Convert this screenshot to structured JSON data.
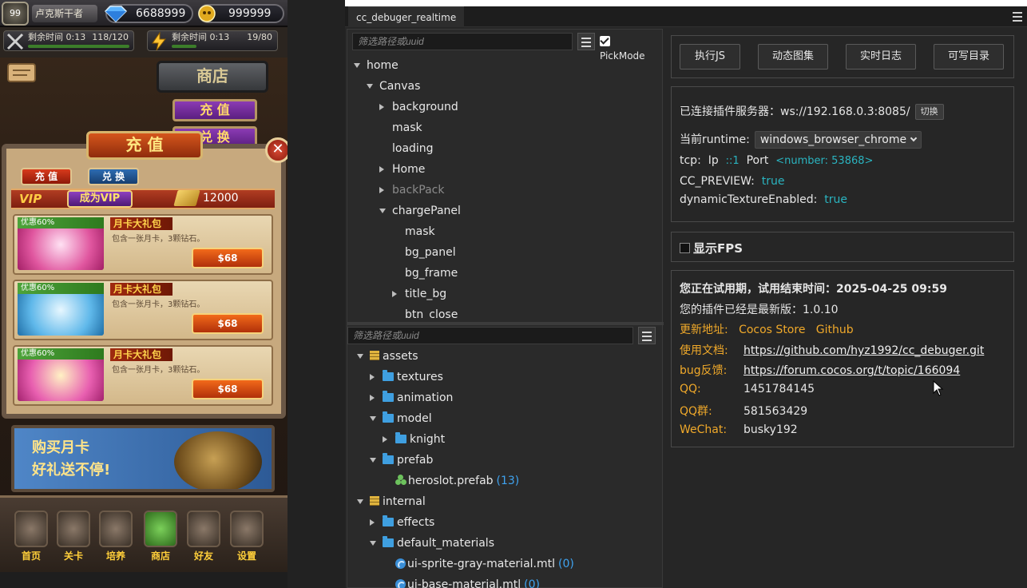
{
  "game": {
    "level": "99",
    "player_name": "卢克斯干者",
    "diamonds": "6688999",
    "gold": "999999",
    "timer1_label": "剩余时间",
    "timer1_time": "0:13",
    "timer1_count": "118/120",
    "timer1_progress": 0.98,
    "timer2_label": "剩余时间",
    "timer2_time": "0:13",
    "timer2_count": "19/80",
    "timer2_progress": 0.24,
    "shop_sign": "商店",
    "recharge_btn": "充 值",
    "second_btn": "兑 换",
    "charge_title": "充 值",
    "close_label": "✕",
    "tab_recharge": "充 值",
    "tab_exchange": "兑 换",
    "vip_label": "VIP",
    "become_vip": "成为VIP",
    "vip_amount": "12000",
    "cards": [
      {
        "discount": "优惠60%",
        "title": "月卡大礼包",
        "desc": "包含一张月卡，3颗钻石。",
        "price": "$68"
      },
      {
        "discount": "优惠60%",
        "title": "月卡大礼包",
        "desc": "包含一张月卡，3颗钻石。",
        "price": "$68"
      },
      {
        "discount": "优惠60%",
        "title": "月卡大礼包",
        "desc": "包含一张月卡，3颗钻石。",
        "price": "$68"
      }
    ],
    "banner_line1": "购买月卡",
    "banner_line2": "好礼送不停!",
    "nav": [
      "首页",
      "关卡",
      "培养",
      "商店",
      "好友",
      "设置"
    ]
  },
  "debuger": {
    "tab_title": "cc_debuger_realtime",
    "node_filter_placeholder": "筛选路径或uuid",
    "pick_mode": "PickMode",
    "node_tree": [
      {
        "label": "home",
        "level": 0,
        "arrow": "down",
        "dim": false
      },
      {
        "label": "Canvas",
        "level": 1,
        "arrow": "down",
        "dim": false
      },
      {
        "label": "background",
        "level": 2,
        "arrow": "right",
        "dim": false
      },
      {
        "label": "mask",
        "level": 2,
        "arrow": "",
        "dim": false
      },
      {
        "label": "loading",
        "level": 2,
        "arrow": "",
        "dim": false
      },
      {
        "label": "Home",
        "level": 2,
        "arrow": "right",
        "dim": false
      },
      {
        "label": "backPack",
        "level": 2,
        "arrow": "right",
        "dim": true
      },
      {
        "label": "chargePanel",
        "level": 2,
        "arrow": "down",
        "dim": false
      },
      {
        "label": "mask",
        "level": 3,
        "arrow": "",
        "dim": false
      },
      {
        "label": "bg_panel",
        "level": 3,
        "arrow": "",
        "dim": false
      },
      {
        "label": "bg_frame",
        "level": 3,
        "arrow": "",
        "dim": false
      },
      {
        "label": "title_bg",
        "level": 3,
        "arrow": "right",
        "dim": false
      },
      {
        "label": "btn_close",
        "level": 3,
        "arrow": "",
        "dim": false
      }
    ],
    "asset_filter_placeholder": "筛选路径或uuid",
    "asset_tree": [
      {
        "label": "assets",
        "level": 0,
        "arrow": "down",
        "icon": "db",
        "count": ""
      },
      {
        "label": "textures",
        "level": 1,
        "arrow": "right",
        "icon": "folder",
        "count": ""
      },
      {
        "label": "animation",
        "level": 1,
        "arrow": "right",
        "icon": "folder",
        "count": ""
      },
      {
        "label": "model",
        "level": 1,
        "arrow": "down",
        "icon": "folder",
        "count": ""
      },
      {
        "label": "knight",
        "level": 2,
        "arrow": "right",
        "icon": "folder",
        "count": ""
      },
      {
        "label": "prefab",
        "level": 1,
        "arrow": "down",
        "icon": "folder",
        "count": ""
      },
      {
        "label": "heroslot.prefab",
        "level": 2,
        "arrow": "",
        "icon": "prefab",
        "count": "(13)"
      },
      {
        "label": "internal",
        "level": 0,
        "arrow": "down",
        "icon": "db",
        "count": ""
      },
      {
        "label": "effects",
        "level": 1,
        "arrow": "right",
        "icon": "folder",
        "count": ""
      },
      {
        "label": "default_materials",
        "level": 1,
        "arrow": "down",
        "icon": "folder",
        "count": ""
      },
      {
        "label": "ui-sprite-gray-material.mtl",
        "level": 2,
        "arrow": "",
        "icon": "mtl",
        "count": "(0)"
      },
      {
        "label": "ui-base-material.mtl",
        "level": 2,
        "arrow": "",
        "icon": "mtl",
        "count": "(0)"
      }
    ],
    "actions": [
      "执行JS",
      "动态图集",
      "实时日志",
      "可写目录"
    ],
    "server_label": "已连接插件服务器：",
    "server_url": "ws://192.168.0.3:8085/",
    "switch_label": "切换",
    "runtime_label": "当前runtime:",
    "runtime_value": "windows_browser_chrome",
    "tcp_label": "tcp:",
    "ip_label": "Ip",
    "ip_value": "::1",
    "port_label": "Port",
    "port_value": "<number: 53868>",
    "preview_label": "CC_PREVIEW:",
    "preview_value": "true",
    "dyn_label": "dynamicTextureEnabled:",
    "dyn_value": "true",
    "fps_label": "显示FPS",
    "trial_text": "您正在试用期，试用结束时间：2025-04-25 09:59",
    "version_text": "您的插件已经是最新版：1.0.10",
    "update_label": "更新地址:",
    "update_store": "Cocos Store",
    "update_github": "Github",
    "docs_label": "使用文档:",
    "docs_url": "https://github.com/hyz1992/cc_debuger.git",
    "bug_label": "bug反馈:",
    "bug_url": "https://forum.cocos.org/t/topic/166094",
    "qq_label": "QQ:",
    "qq_value": "1451784145",
    "qqgroup_label": "QQ群:",
    "qqgroup_value": "581563429",
    "wechat_label": "WeChat:",
    "wechat_value": "busky192"
  }
}
